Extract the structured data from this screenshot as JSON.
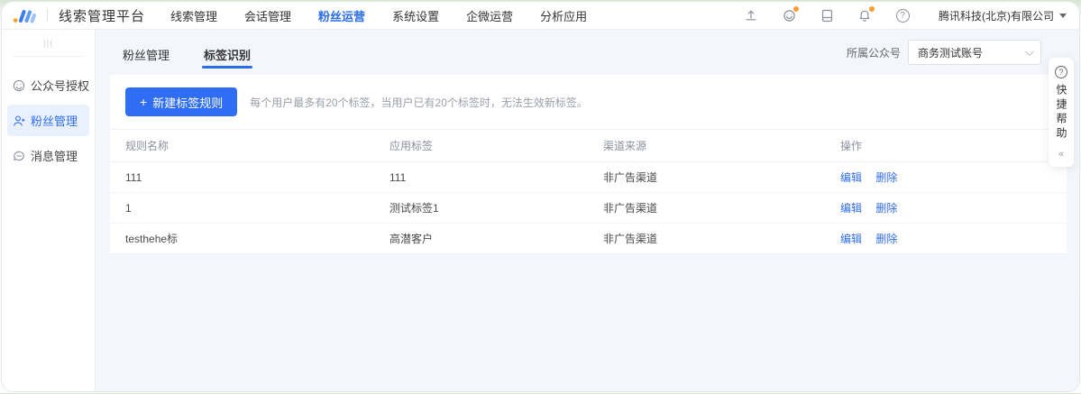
{
  "header": {
    "brand": "线索管理平台",
    "nav_items": [
      {
        "label": "线索管理"
      },
      {
        "label": "会话管理"
      },
      {
        "label": "粉丝运营"
      },
      {
        "label": "系统设置"
      },
      {
        "label": "企微运营"
      },
      {
        "label": "分析应用"
      }
    ],
    "company": "腾讯科技(北京)有限公司",
    "badge_color": "#ff9c33",
    "accent_color": "#2b6cea"
  },
  "sidebar": {
    "top_mark": ")|(",
    "items": [
      {
        "label": "公众号授权"
      },
      {
        "label": "粉丝管理"
      },
      {
        "label": "消息管理"
      }
    ]
  },
  "main": {
    "tabs": [
      {
        "label": "粉丝管理"
      },
      {
        "label": "标签识别"
      }
    ],
    "account_filter": {
      "label": "所属公众号",
      "value": "商务测试账号"
    },
    "new_rule_button": {
      "icon": "+",
      "label": "新建标签规则"
    },
    "note": "每个用户最多有20个标签，当用户已有20个标签时，无法生效新标签。",
    "table": {
      "columns": [
        "规则名称",
        "应用标签",
        "渠道来源",
        "操作"
      ],
      "rows": [
        {
          "rule_name": "111",
          "tag": "111",
          "source": "非广告渠道",
          "actions": [
            "编辑",
            "删除"
          ]
        },
        {
          "rule_name": "1",
          "tag": "测试标签1",
          "source": "非广告渠道",
          "actions": [
            "编辑",
            "删除"
          ]
        },
        {
          "rule_name": "testhehe标",
          "tag": "高潜客户",
          "source": "非广告渠道",
          "actions": [
            "编辑",
            "删除"
          ]
        }
      ]
    }
  },
  "help_panel": {
    "text": "快捷帮助",
    "collapse": "«"
  }
}
